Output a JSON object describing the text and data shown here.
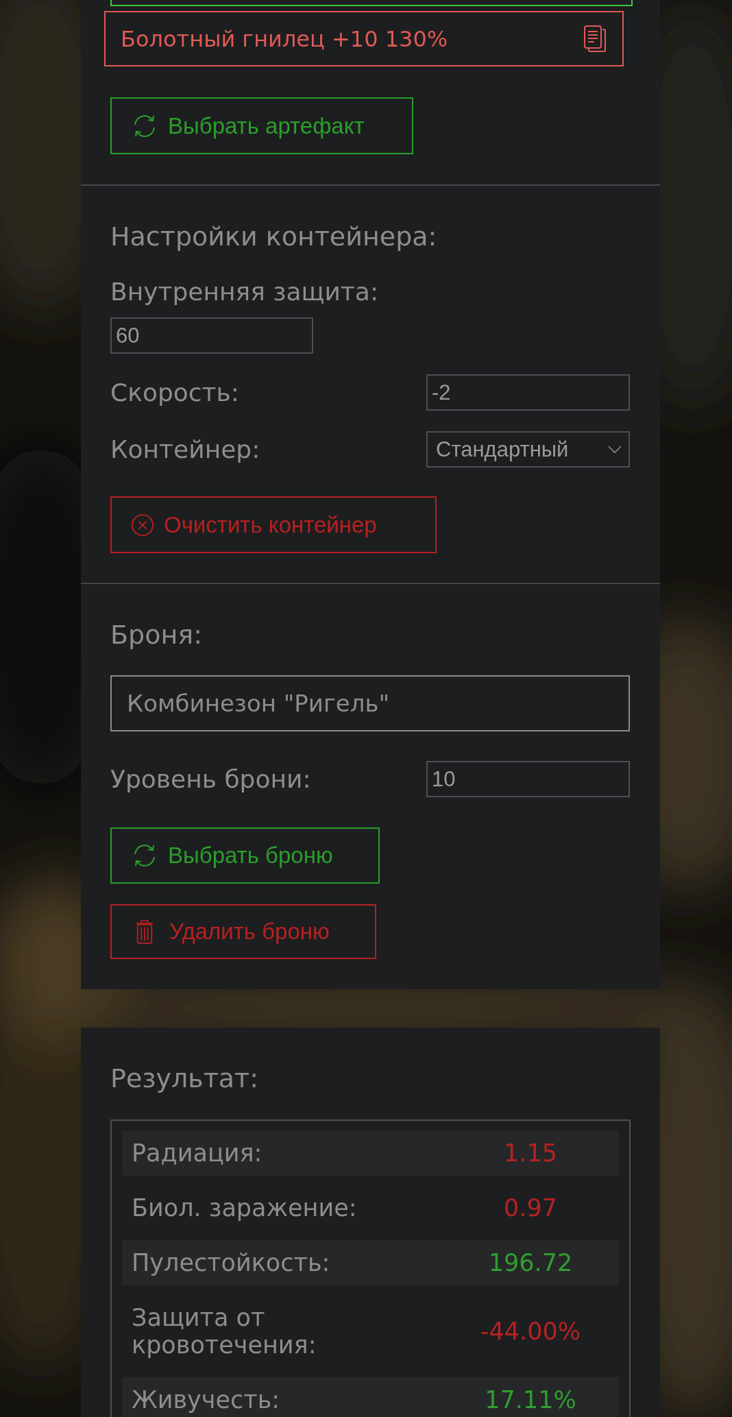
{
  "artifact": {
    "name": "Болотный гнилец +10 130%"
  },
  "select_artifact_button": "Выбрать артефакт",
  "container_settings": {
    "title": "Настройки контейнера:",
    "fields": [
      {
        "label": "Внутренняя защита:",
        "value": "60",
        "kind": "stacked"
      },
      {
        "label": "Скорость:",
        "value": "-2",
        "kind": "inline"
      },
      {
        "label": "Контейнер:",
        "value": "Стандартный",
        "kind": "select"
      }
    ],
    "clear_button": "Очистить контейнер"
  },
  "armor": {
    "title": "Броня:",
    "name": "Комбинезон \"Ригель\"",
    "level_label": "Уровень брони:",
    "level_value": "10",
    "select_button": "Выбрать броню",
    "delete_button": "Удалить броню"
  },
  "result": {
    "title": "Результат:",
    "rows": [
      {
        "label": "Радиация:",
        "value": "1.15",
        "color": "#b52222"
      },
      {
        "label": "Биол. заражение:",
        "value": "0.97",
        "color": "#b52222"
      },
      {
        "label": "Пулестойкость:",
        "value": "196.72",
        "color": "#2f9e2f"
      },
      {
        "label": "Защита от кровотечения:",
        "value": "-44.00%",
        "color": "#b52222"
      },
      {
        "label": "Живучесть:",
        "value": "17.11%",
        "color": "#2f9e2f"
      }
    ]
  }
}
